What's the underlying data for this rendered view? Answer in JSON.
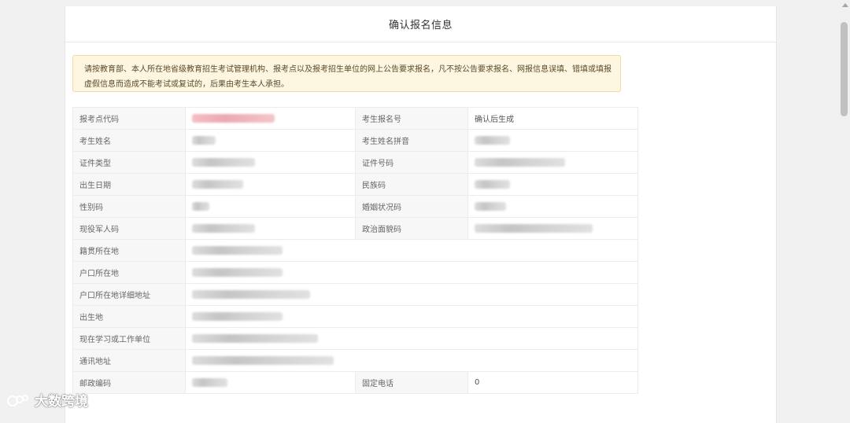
{
  "header": {
    "title": "确认报名信息"
  },
  "notice": {
    "text": "请按教育部、本人所在地省级教育招生考试管理机构、报考点以及报考招生单位的网上公告要求报名，凡不按公告要求报名、网报信息误填、错填或填报虚假信息而造成不能考试或复试的，后果由考生本人承担。"
  },
  "table": {
    "rows": [
      {
        "label1": "报考点代码",
        "value1": "",
        "label2": "考生报名号",
        "value2": "确认后生成"
      },
      {
        "label1": "考生姓名",
        "value1": "",
        "label2": "考生姓名拼音",
        "value2": ""
      },
      {
        "label1": "证件类型",
        "value1": "",
        "label2": "证件号码",
        "value2": ""
      },
      {
        "label1": "出生日期",
        "value1": "",
        "label2": "民族码",
        "value2": ""
      },
      {
        "label1": "性别码",
        "value1": "",
        "label2": "婚姻状况码",
        "value2": ""
      },
      {
        "label1": "现役军人码",
        "value1": "",
        "label2": "政治面貌码",
        "value2": ""
      },
      {
        "label1": "籍贯所在地",
        "value1": ""
      },
      {
        "label1": "户口所在地",
        "value1": ""
      },
      {
        "label1": "户口所在地详细地址",
        "value1": ""
      },
      {
        "label1": "出生地",
        "value1": ""
      },
      {
        "label1": "现在学习或工作单位",
        "value1": ""
      },
      {
        "label1": "通讯地址",
        "value1": ""
      },
      {
        "label1": "邮政编码",
        "value1": "",
        "label2": "固定电话",
        "value2": "0"
      }
    ]
  },
  "watermark": {
    "text": "大数跨境"
  },
  "colors": {
    "accent_red": "#e0393e",
    "notice_bg": "#fdf6e1",
    "notice_border": "#f5d9a3"
  }
}
